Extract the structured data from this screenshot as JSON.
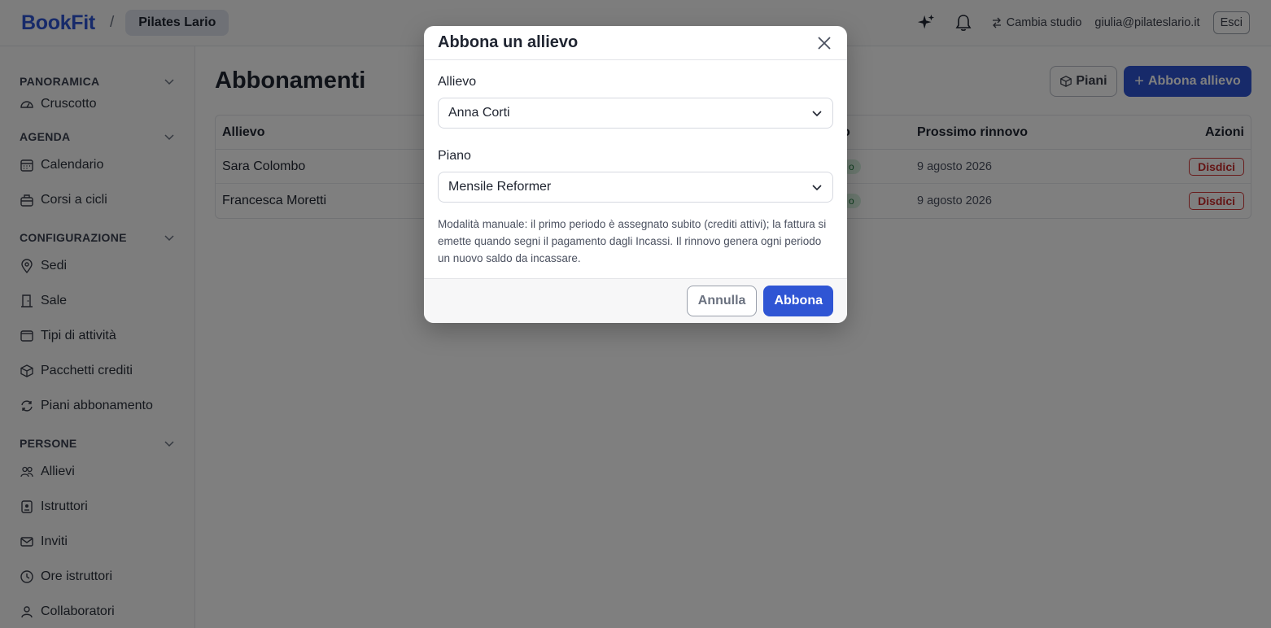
{
  "header": {
    "brand": "BookFit",
    "separator": "/",
    "studio": "Pilates Lario",
    "switch_label": "Cambia studio",
    "email": "giulia@pilateslario.it",
    "logout": "Esci"
  },
  "sidebar": {
    "sections": [
      {
        "title": "PANORAMICA",
        "items": [
          {
            "label": "Cruscotto",
            "icon": "dashboard-icon"
          }
        ]
      },
      {
        "title": "AGENDA",
        "items": [
          {
            "label": "Calendario",
            "icon": "calendar-icon"
          },
          {
            "label": "Corsi a cicli",
            "icon": "briefcase-icon"
          }
        ]
      },
      {
        "title": "CONFIGURAZIONE",
        "items": [
          {
            "label": "Sedi",
            "icon": "location-icon"
          },
          {
            "label": "Sale",
            "icon": "door-icon"
          },
          {
            "label": "Tipi di attività",
            "icon": "tag-icon"
          },
          {
            "label": "Pacchetti crediti",
            "icon": "package-icon"
          },
          {
            "label": "Piani abbonamento",
            "icon": "refresh-icon"
          }
        ]
      },
      {
        "title": "PERSONE",
        "items": [
          {
            "label": "Allievi",
            "icon": "users-icon"
          },
          {
            "label": "Istruttori",
            "icon": "badge-icon"
          },
          {
            "label": "Inviti",
            "icon": "mail-icon"
          },
          {
            "label": "Ore istruttori",
            "icon": "clock-icon"
          },
          {
            "label": "Collaboratori",
            "icon": "user-icon"
          }
        ]
      }
    ]
  },
  "main": {
    "title": "Abbonamenti",
    "plans_button": "Piani",
    "subscribe_button": "Abbona allievo",
    "table": {
      "headers": {
        "student": "Allievo",
        "status": "o",
        "renewal": "Prossimo rinnovo",
        "actions": "Azioni"
      },
      "rows": [
        {
          "student": "Sara Colombo",
          "status": "o",
          "renewal": "9 agosto 2026",
          "action": "Disdici"
        },
        {
          "student": "Francesca Moretti",
          "status": "o",
          "renewal": "9 agosto 2026",
          "action": "Disdici"
        }
      ]
    }
  },
  "modal": {
    "title": "Abbona un allievo",
    "student_label": "Allievo",
    "student_value": "Anna Corti",
    "plan_label": "Piano",
    "plan_value": "Mensile Reformer",
    "hint": "Modalità manuale: il primo periodo è assegnato subito (crediti attivi); la fattura si emette quando segni il pagamento dagli Incassi. Il rinnovo genera ogni periodo un nuovo saldo da incassare.",
    "cancel": "Annulla",
    "confirm": "Abbona"
  },
  "colors": {
    "accent": "#2f55d4",
    "danger": "#c92a2a",
    "success_bg": "#d7f1df"
  }
}
